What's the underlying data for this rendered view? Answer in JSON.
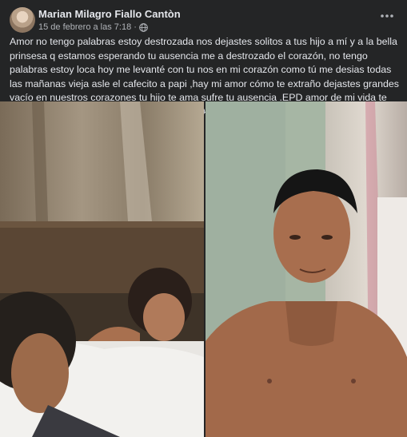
{
  "post": {
    "author": "Marian Milagro Fiallo Cantòn",
    "timestamp": "15 de febrero a las 7:18",
    "separator": "·",
    "text": "Amor no tengo palabras estoy destrozada nos dejastes solitos a tus hijo a mí y a la bella prinsesa q estamos esperando tu ausencia me a destrozado el corazón, no tengo palabras estoy loca hoy me levanté con tu nos en mi corazón como tú me desias todas las mañanas vieja asle el cafecito a papi ,hay mi amor cómo te extraño dejastes grandes vacío en nuestros corazones tu hijo te ama sufre tu ausencia .EPD amor de mi vida te amooooooooooooo propio😭😭😭😭😭😭😭😭"
  },
  "icons": {
    "audience": "globe-icon",
    "more": "more-options-icon"
  },
  "photos": [
    {
      "name": "photo-couple-in-bed"
    },
    {
      "name": "photo-man-shirtless"
    }
  ],
  "colors": {
    "card_background": "#242526",
    "primary_text": "#e4e6eb",
    "secondary_text": "#b0b3b8"
  }
}
